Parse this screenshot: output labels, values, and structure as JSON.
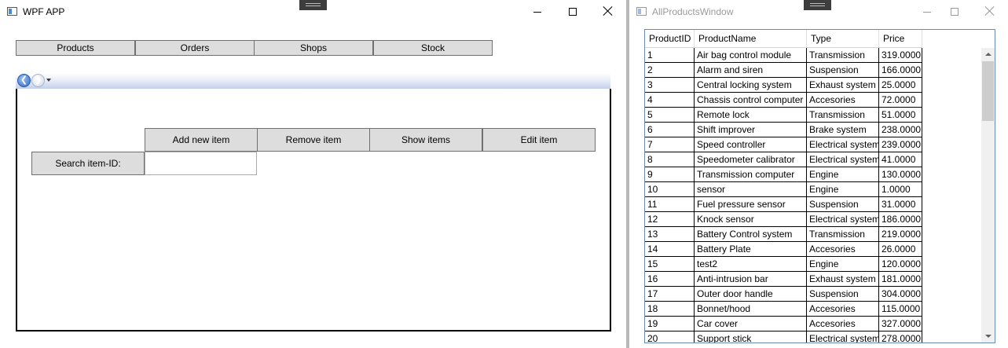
{
  "main_window": {
    "title": "WPF APP",
    "menu": [
      "Products",
      "Orders",
      "Shops",
      "Stock"
    ],
    "actions": [
      "Add new item",
      "Remove item",
      "Show items",
      "Edit item"
    ],
    "search": {
      "label": "Search item-ID:",
      "value": ""
    }
  },
  "products_window": {
    "title": "AllProductsWindow",
    "columns": [
      "ProductID",
      "ProductName",
      "Type",
      "Price"
    ],
    "rows": [
      [
        "1",
        "Air bag control module",
        "Transmission",
        "319.0000"
      ],
      [
        "2",
        "Alarm and siren",
        "Suspension",
        "166.0000"
      ],
      [
        "3",
        "Central locking system",
        "Exhaust system",
        "25.0000"
      ],
      [
        "4",
        "Chassis control computer",
        "Accesories",
        "72.0000"
      ],
      [
        "5",
        "Remote lock",
        "Transmission",
        "51.0000"
      ],
      [
        "6",
        "Shift improver",
        "Brake system",
        "238.0000"
      ],
      [
        "7",
        "Speed controller",
        "Electrical system",
        "239.0000"
      ],
      [
        "8",
        "Speedometer calibrator",
        "Electrical system",
        "41.0000"
      ],
      [
        "9",
        "Transmission computer",
        "Engine",
        "130.0000"
      ],
      [
        "10",
        "sensor",
        "Engine",
        "1.0000"
      ],
      [
        "11",
        "Fuel pressure sensor",
        "Suspension",
        "31.0000"
      ],
      [
        "12",
        "Knock sensor",
        "Electrical system",
        "186.0000"
      ],
      [
        "13",
        "Battery Control system",
        "Transmission",
        "219.0000"
      ],
      [
        "14",
        "Battery Plate",
        "Accesories",
        "26.0000"
      ],
      [
        "15",
        "test2",
        "Engine",
        "120.0000"
      ],
      [
        "16",
        "Anti-intrusion bar",
        "Exhaust system",
        "181.0000"
      ],
      [
        "17",
        "Outer door handle",
        "Suspension",
        "304.0000"
      ],
      [
        "18",
        "Bonnet/hood",
        "Accesories",
        "115.0000"
      ],
      [
        "19",
        "Car cover",
        "Accesories",
        "327.0000"
      ],
      [
        "20",
        "Support stick",
        "Electrical system",
        "278.0000"
      ]
    ]
  }
}
